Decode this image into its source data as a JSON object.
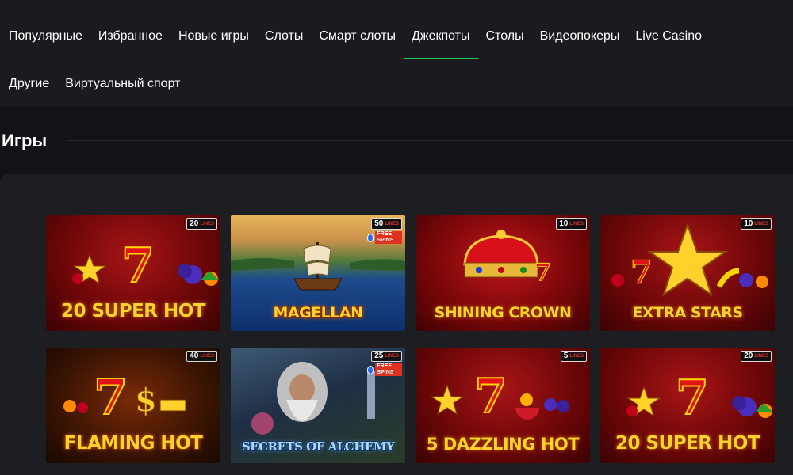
{
  "nav": {
    "row1": [
      "Популярные",
      "Избранное",
      "Новые игры",
      "Слоты",
      "Смарт слоты",
      "Джекпоты",
      "Столы",
      "Видеопокеры",
      "Live Casino"
    ],
    "row2": [
      "Другие",
      "Виртуальный спорт"
    ],
    "active": "Джекпоты",
    "accent": "#22c55e"
  },
  "section": {
    "title": "Игры"
  },
  "games": [
    {
      "title": "20 SUPER HOT",
      "lines": "20",
      "lines_label": "LINES",
      "theme": "red",
      "icon": "seven-fruits"
    },
    {
      "title": "MAGELLAN",
      "lines": "50",
      "lines_label": "LINES",
      "free_spins": "FREE SPINS",
      "theme": "sea",
      "icon": "ship"
    },
    {
      "title": "SHINING CROWN",
      "lines": "10",
      "lines_label": "LINES",
      "theme": "crown",
      "icon": "crown"
    },
    {
      "title": "EXTRA STARS",
      "lines": "10",
      "lines_label": "LINES",
      "theme": "red",
      "icon": "star-fruits"
    },
    {
      "title": "FLAMING HOT",
      "lines": "40",
      "lines_label": "LINES",
      "theme": "flame",
      "icon": "seven-dollar"
    },
    {
      "title": "SECRETS OF ALCHEMY",
      "lines": "25",
      "lines_label": "LINES",
      "free_spins": "FREE SPINS",
      "theme": "dark",
      "icon": "wizard"
    },
    {
      "title": "5 DAZZLING HOT",
      "lines": "5",
      "lines_label": "LINES",
      "theme": "red",
      "icon": "seven-fruits"
    },
    {
      "title": "20 SUPER HOT",
      "lines": "20",
      "lines_label": "LINES",
      "theme": "red",
      "icon": "seven-fruits"
    }
  ]
}
